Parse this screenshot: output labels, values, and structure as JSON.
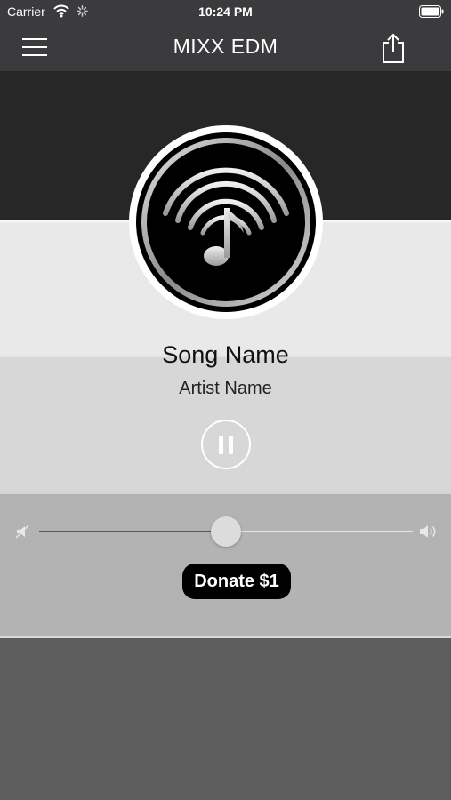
{
  "status_bar": {
    "carrier": "Carrier",
    "time": "10:24 PM"
  },
  "nav": {
    "title": "MIXX EDM",
    "menu_icon": "hamburger-icon",
    "share_icon": "share-icon"
  },
  "player": {
    "artwork_icon": "radio-music-note-icon",
    "song_name": "Song Name",
    "artist_name": "Artist Name",
    "state": "playing",
    "pause_icon": "pause-icon"
  },
  "volume": {
    "level": 0.5,
    "min_icon": "speaker-mute-icon",
    "max_icon": "speaker-loud-icon"
  },
  "donate_label": "Donate $1",
  "colors": {
    "nav_bg": "#3b3b3e",
    "donate_bg": "#000000"
  }
}
